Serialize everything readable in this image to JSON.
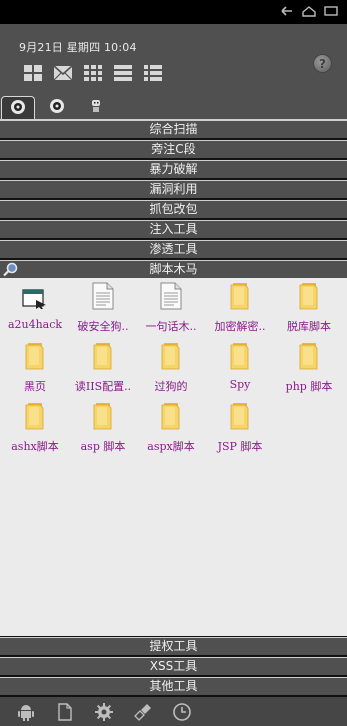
{
  "header": {
    "datetime": "9月21日  星期四  10:04",
    "help_label": "?"
  },
  "categories_top": [
    "综合扫描",
    "旁注C段",
    "暴力破解",
    "漏洞利用",
    "抓包改包",
    "注入工具",
    "渗透工具",
    "脚本木马"
  ],
  "files": [
    {
      "label": "a2u4hack",
      "icon": "app-window-icon"
    },
    {
      "label": "破安全狗..",
      "icon": "document-icon"
    },
    {
      "label": "一句话木..",
      "icon": "document-icon"
    },
    {
      "label": "加密解密..",
      "icon": "folder-icon"
    },
    {
      "label": "脱库脚本",
      "icon": "folder-icon"
    },
    {
      "label": "黑页",
      "icon": "folder-icon"
    },
    {
      "label": "读IIS配置..",
      "icon": "folder-icon"
    },
    {
      "label": "过狗的",
      "icon": "folder-icon"
    },
    {
      "label": "Spy",
      "icon": "folder-icon"
    },
    {
      "label": "php 脚本",
      "icon": "folder-icon"
    },
    {
      "label": "ashx脚本",
      "icon": "folder-icon"
    },
    {
      "label": "asp 脚本",
      "icon": "folder-icon"
    },
    {
      "label": "aspx脚本",
      "icon": "folder-icon"
    },
    {
      "label": "JSP 脚本",
      "icon": "folder-icon"
    }
  ],
  "categories_bottom": [
    "提权工具",
    "XSS工具",
    "其他工具"
  ],
  "colors": {
    "file_label": "#8b1a8b",
    "panel": "#505050",
    "grid_bg": "#ebebeb"
  }
}
